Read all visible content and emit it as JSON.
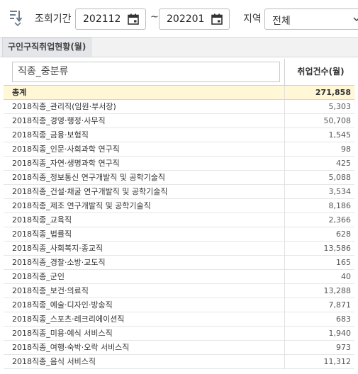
{
  "filters": {
    "period_label": "조회기간",
    "from_value": "202112",
    "tilde": "~",
    "to_value": "202201",
    "region_label": "지역",
    "region_value": "전체"
  },
  "tab": {
    "label": "구인구직취업현황(월)"
  },
  "table": {
    "col_name_header": "직종_중분류",
    "col_count_header": "취업건수(월)",
    "rows": [
      {
        "name": "총계",
        "count": "271,858"
      },
      {
        "name": "2018직종_관리직(임원·부서장)",
        "count": "5,303"
      },
      {
        "name": "2018직종_경영·행정·사무직",
        "count": "50,708"
      },
      {
        "name": "2018직종_금융·보험직",
        "count": "1,545"
      },
      {
        "name": "2018직종_인문·사회과학 연구직",
        "count": "98"
      },
      {
        "name": "2018직종_자연·생명과학 연구직",
        "count": "425"
      },
      {
        "name": "2018직종_정보통신 연구개발직 및 공학기술직",
        "count": "5,088"
      },
      {
        "name": "2018직종_건설·채굴 연구개발직 및 공학기술직",
        "count": "3,534"
      },
      {
        "name": "2018직종_제조 연구개발직 및 공학기술직",
        "count": "8,186"
      },
      {
        "name": "2018직종_교육직",
        "count": "2,366"
      },
      {
        "name": "2018직종_법률직",
        "count": "628"
      },
      {
        "name": "2018직종_사회복지·종교직",
        "count": "13,586"
      },
      {
        "name": "2018직종_경찰·소방·교도직",
        "count": "165"
      },
      {
        "name": "2018직종_군인",
        "count": "40"
      },
      {
        "name": "2018직종_보건·의료직",
        "count": "13,288"
      },
      {
        "name": "2018직종_예술·디자인·방송직",
        "count": "7,871"
      },
      {
        "name": "2018직종_스포츠·레크리에이션직",
        "count": "683"
      },
      {
        "name": "2018직종_미용·예식 서비스직",
        "count": "1,940"
      },
      {
        "name": "2018직종_여행·숙박·오락 서비스직",
        "count": "973"
      },
      {
        "name": "2018직종_음식 서비스직",
        "count": "11,312"
      }
    ]
  }
}
